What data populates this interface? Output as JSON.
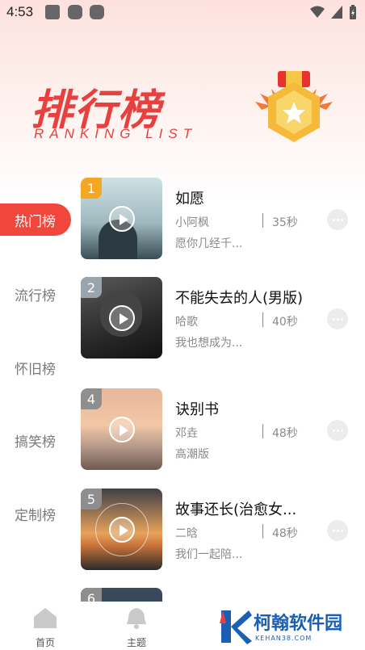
{
  "status_bar": {
    "time": "4:53"
  },
  "banner": {
    "title": "排行榜",
    "subtitle": "RANKING LIST"
  },
  "categories": [
    {
      "label": "热门榜",
      "active": true
    },
    {
      "label": "流行榜",
      "active": false
    },
    {
      "label": "怀旧榜",
      "active": false
    },
    {
      "label": "搞笑榜",
      "active": false
    },
    {
      "label": "定制榜",
      "active": false
    }
  ],
  "songs": [
    {
      "rank": "1",
      "title": "如愿",
      "artist": "小阿枫",
      "duration": "35秒",
      "desc": "愿你几经千...",
      "badge_color": "#f5a623"
    },
    {
      "rank": "2",
      "title": "不能失去的人(男版)",
      "artist": "哈歌",
      "duration": "40秒",
      "desc": "我也想成为...",
      "badge_color": "#9aa4ad"
    },
    {
      "rank": "4",
      "title": "诀别书",
      "artist": "邓垚",
      "duration": "48秒",
      "desc": "高潮版",
      "badge_color": "#8e8e8e"
    },
    {
      "rank": "5",
      "title": "故事还长(治愈女...",
      "artist": "二晗",
      "duration": "48秒",
      "desc": "我们一起陪...",
      "badge_color": "#8e8e8e"
    },
    {
      "rank": "6"
    }
  ],
  "bottom_nav": [
    {
      "label": "首页",
      "icon": "home-icon"
    },
    {
      "label": "主题",
      "icon": "bell-icon"
    }
  ],
  "watermark": {
    "text": "柯翰软件园",
    "sub": "KEHAN38.COM"
  }
}
